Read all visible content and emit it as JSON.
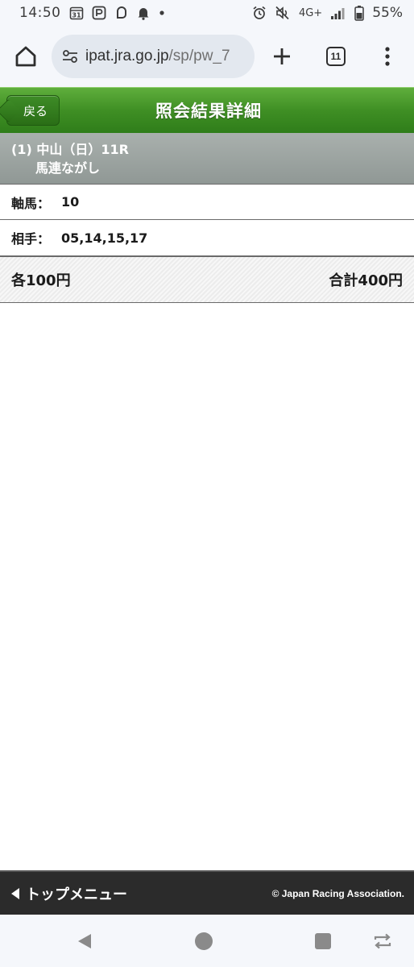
{
  "status_bar": {
    "time": "14:50",
    "calendar_day": "31",
    "network": "4G+",
    "battery": "55%"
  },
  "browser": {
    "url_main": "ipat.jra.go.jp",
    "url_path": "/sp/pw_7",
    "tab_count": "11"
  },
  "header": {
    "back_label": "戻る",
    "title": "照会結果詳細"
  },
  "race": {
    "line1": "(1) 中山（日）11R",
    "bet_type": "馬連ながし"
  },
  "details": {
    "axis_label": "軸馬：",
    "axis_value": "10",
    "partner_label": "相手：",
    "partner_value": "05,14,15,17"
  },
  "totals": {
    "each": "各100円",
    "sum": "合計400円"
  },
  "footer": {
    "top_menu": "トップメニュー",
    "copyright": "© Japan Racing Association."
  },
  "colors": {
    "header_green": "#3f8f24",
    "race_band_gray": "#9aa19e",
    "footer_dark": "#2b2b2b"
  }
}
